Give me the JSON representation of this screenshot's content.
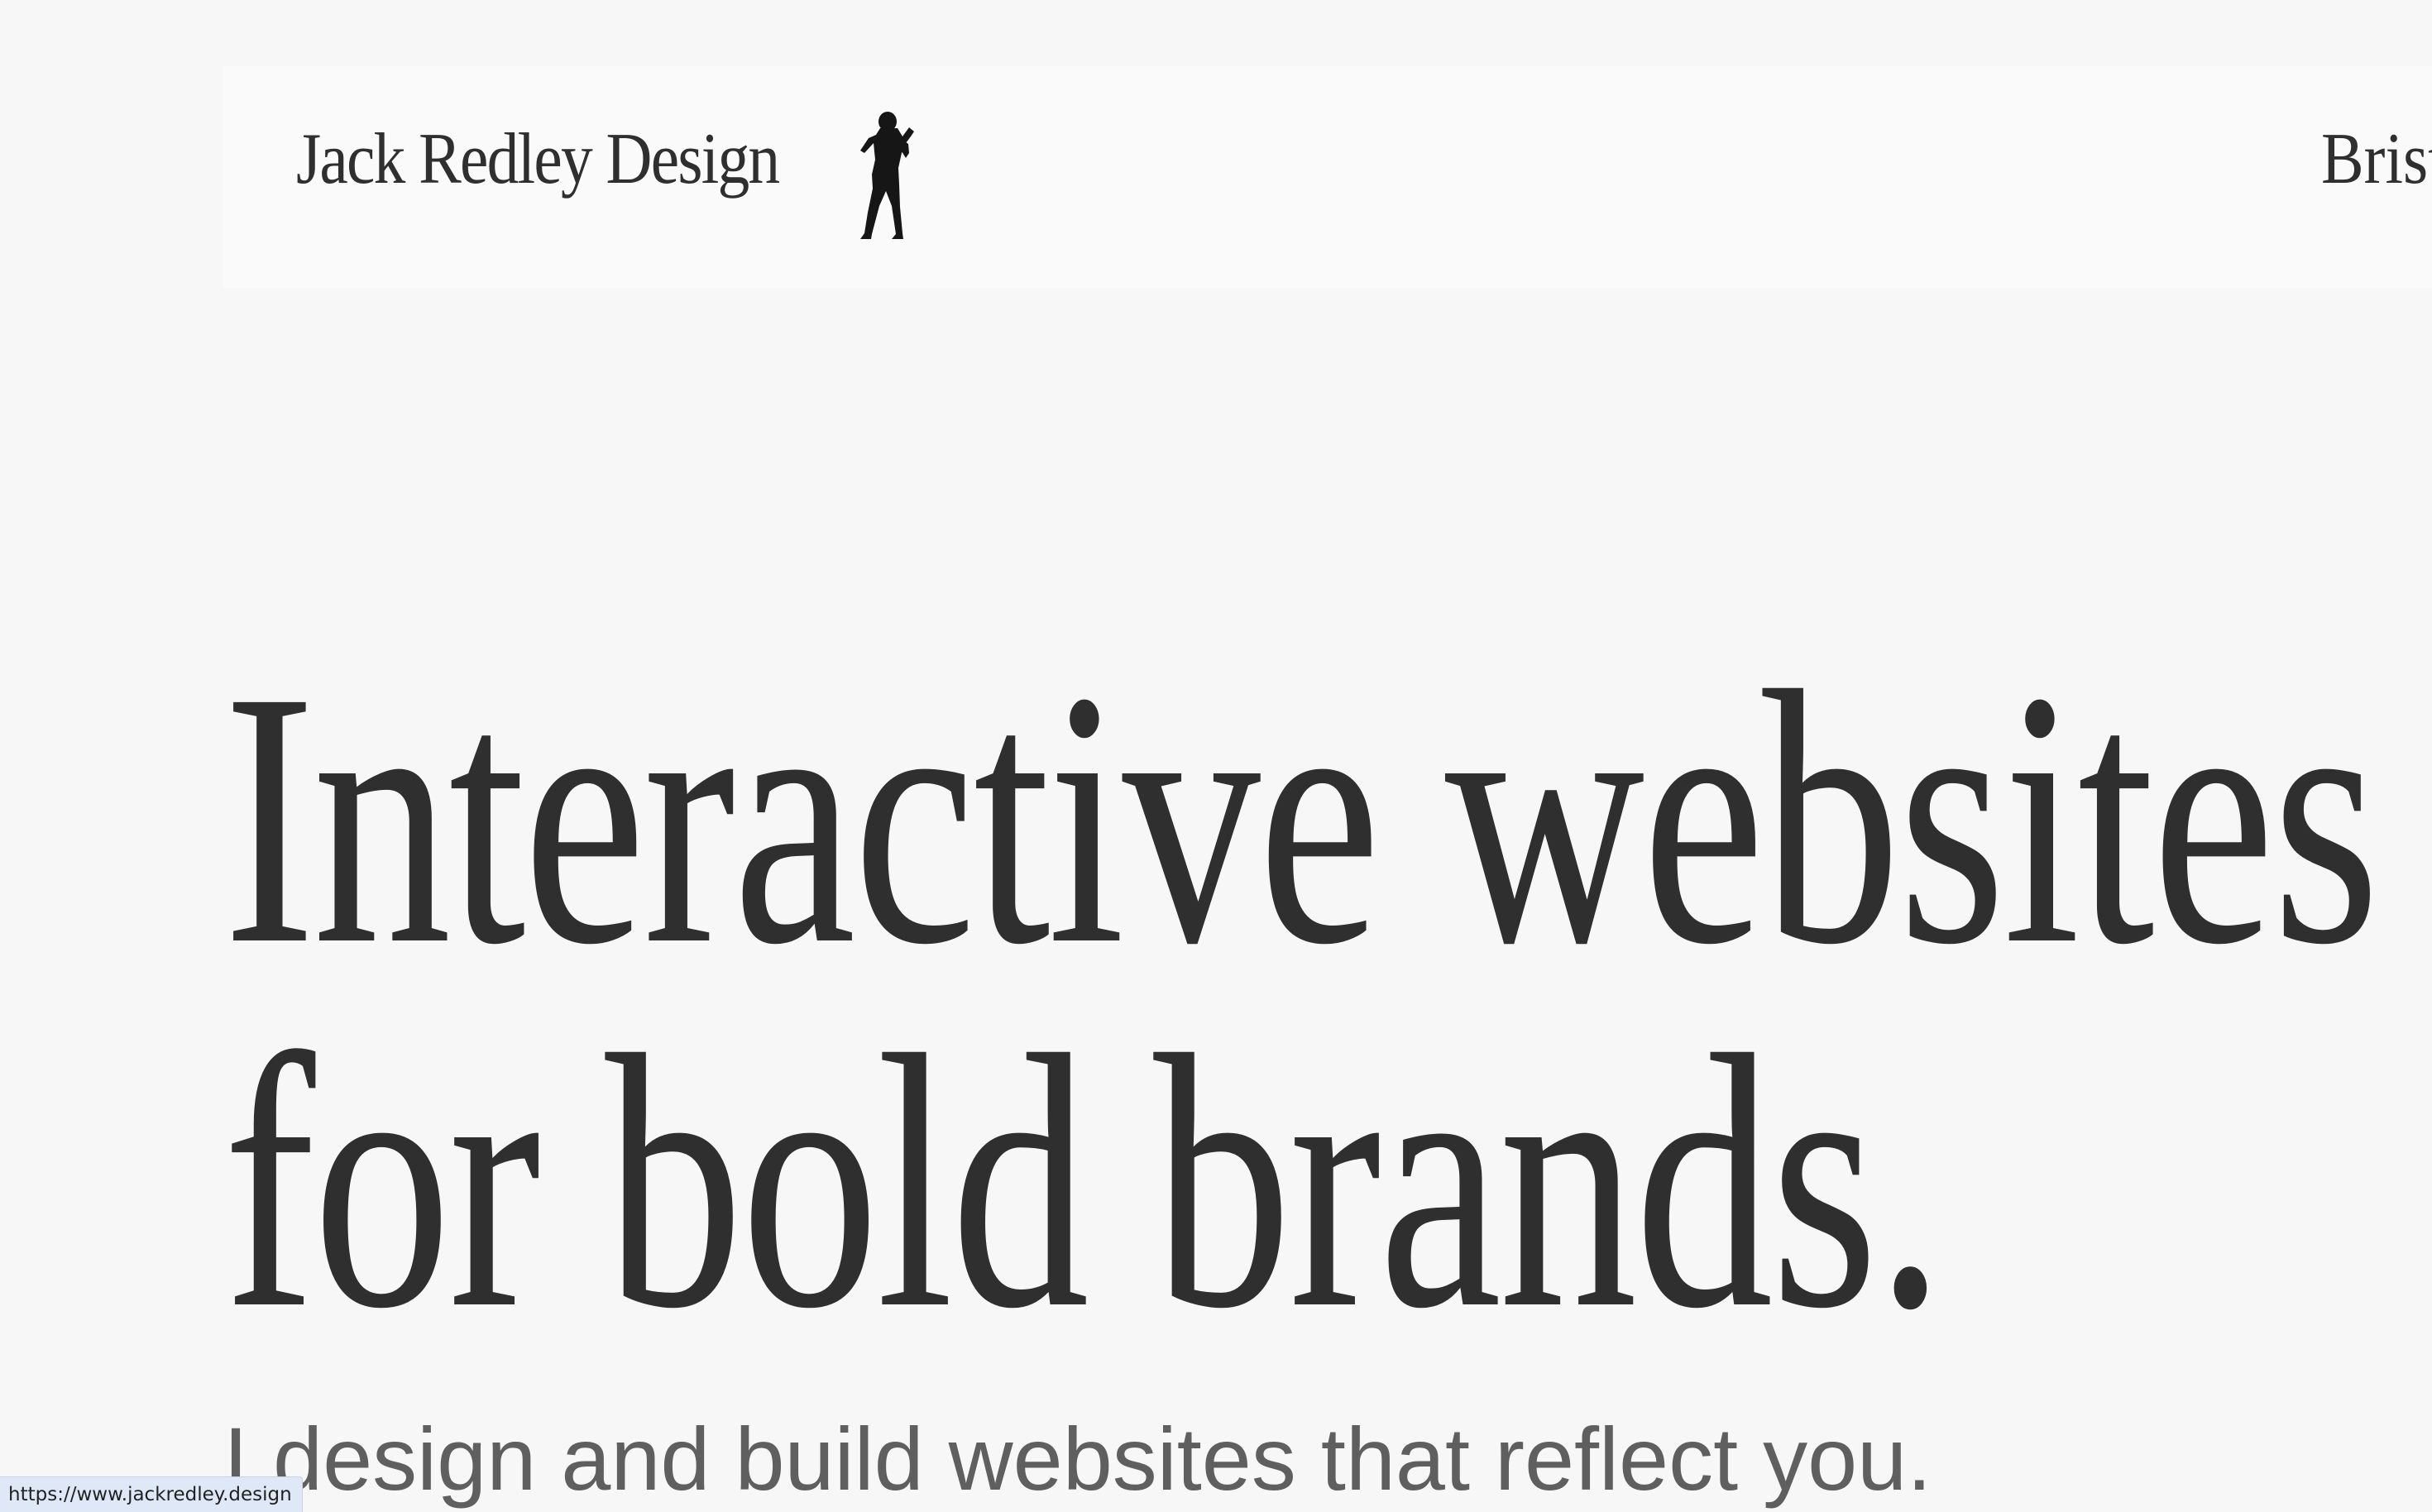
{
  "header": {
    "brand": "Jack Redley Design",
    "logo_icon": "dancing-figure-icon",
    "location": "Brist"
  },
  "hero": {
    "title_line1": "Interactive websites",
    "title_line2": "for bold brands.",
    "subtitle": "I design and build websites that reflect you."
  },
  "status_bar": {
    "url": "https://www.jackredley.design"
  },
  "colors": {
    "background": "#f7f7f7",
    "header_background": "#fafafa",
    "text": "#2f2f2f",
    "subtitle_text": "#5f5f5f",
    "status_background": "#dfe8f7"
  }
}
